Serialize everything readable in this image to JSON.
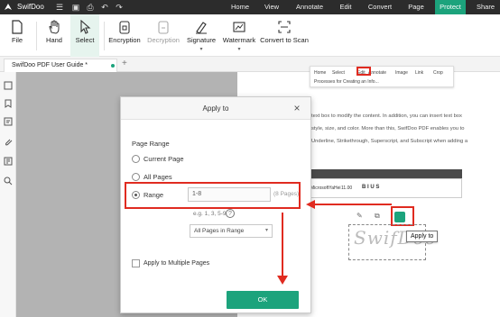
{
  "app": {
    "name": "SwifDoo",
    "menu": [
      "Home",
      "View",
      "Annotate",
      "Edit",
      "Convert",
      "Page",
      "Protect",
      "Share"
    ],
    "active_menu": "Protect",
    "accent_color": "#1ca37c",
    "annotation_color": "#e02b20"
  },
  "ribbon": {
    "file": "File",
    "hand": "Hand",
    "select": "Select",
    "encryption": "Encryption",
    "decryption": "Decryption",
    "signature": "Signature",
    "watermark": "Watermark",
    "convert_to_scan": "Convert to Scan"
  },
  "tabs": {
    "doc_title": "SwifDoo PDF User Guide *",
    "add": "+"
  },
  "document": {
    "mini_toolbar": [
      "Home",
      "Select",
      "Edit",
      "Annotate",
      "Image",
      "Link",
      "Crop"
    ],
    "mini_sub": "Processes for Creating an Info...",
    "lines": [
      "text box to modify the content. In addition, you can insert text box",
      "style, size, and color. More than this, SwifDoo PDF enables you to",
      "Underline, Strikethrough, Superscript, and Subscript when adding a"
    ],
    "font_select": "MicrosoftYaHei",
    "font_size": "11.00",
    "signature_text": "SwifDoo",
    "tooltip": "Apply to"
  },
  "dialog": {
    "title": "Apply to",
    "close": "×",
    "section": "Page Range",
    "options": [
      "Current Page",
      "All Pages",
      "Range"
    ],
    "selected_option": "Range",
    "range_value": "1-8",
    "range_pages": "(8 Pages)",
    "range_hint": "e.g. 1, 3, 5-9",
    "hint_icon": "?",
    "subset": "All Pages in Range",
    "apply_multiple": "Apply to Multiple Pages",
    "ok": "OK"
  }
}
